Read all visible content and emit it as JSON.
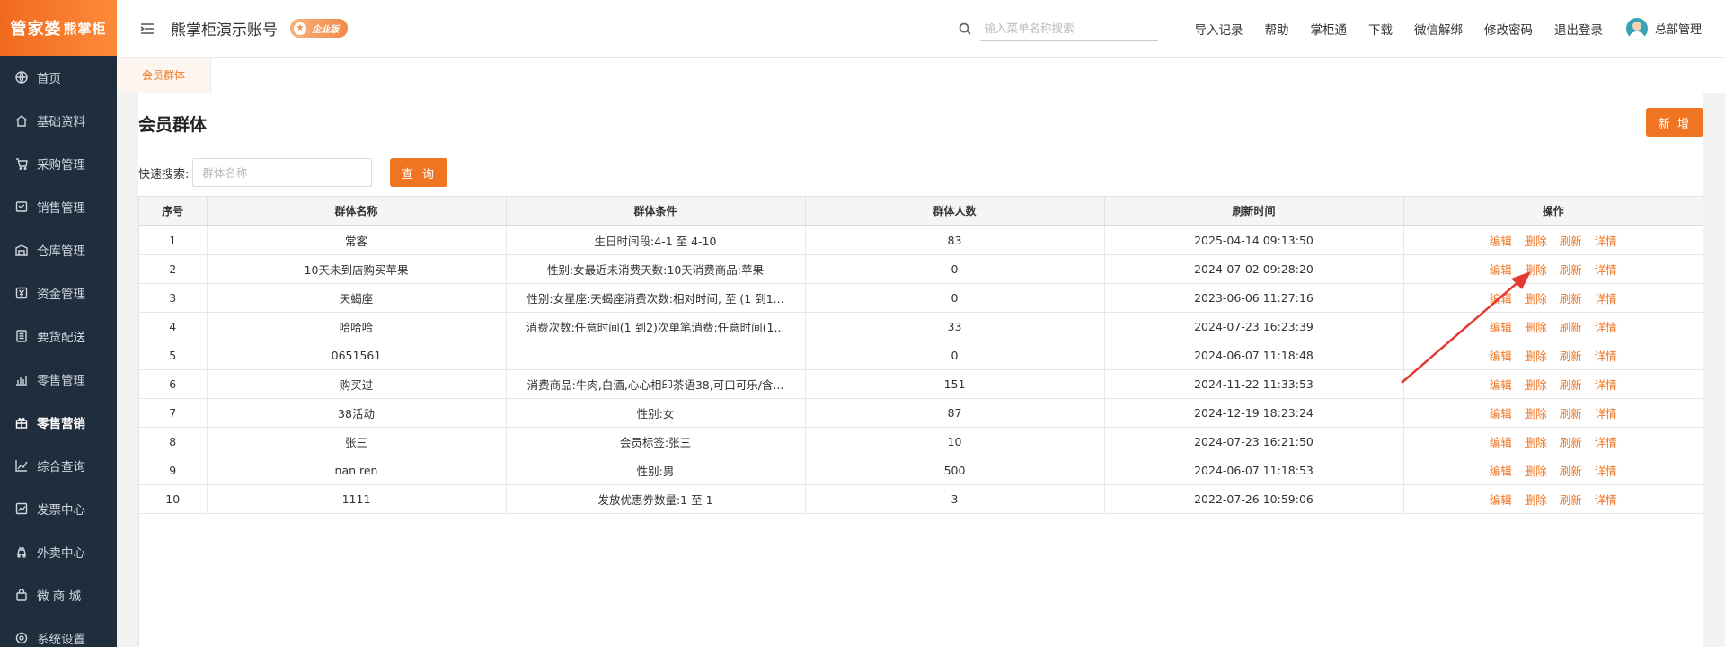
{
  "sidebar": {
    "logo_main": "管家婆",
    "logo_sub": "熊掌柜",
    "items": [
      {
        "label": "首页",
        "icon": "globe-icon"
      },
      {
        "label": "基础资料",
        "icon": "home-icon"
      },
      {
        "label": "采购管理",
        "icon": "cart-icon"
      },
      {
        "label": "销售管理",
        "icon": "sales-icon"
      },
      {
        "label": "仓库管理",
        "icon": "warehouse-icon"
      },
      {
        "label": "资金管理",
        "icon": "money-icon"
      },
      {
        "label": "要货配送",
        "icon": "document-icon"
      },
      {
        "label": "零售管理",
        "icon": "bar-chart-icon"
      },
      {
        "label": "零售营销",
        "icon": "gift-icon"
      },
      {
        "label": "综合查询",
        "icon": "line-chart-icon"
      },
      {
        "label": "发票中心",
        "icon": "trend-icon"
      },
      {
        "label": "外卖中心",
        "icon": "delivery-icon"
      },
      {
        "label": "微 商 城",
        "icon": "bag-icon"
      },
      {
        "label": "系统设置",
        "icon": "settings-icon"
      }
    ]
  },
  "header": {
    "account_name": "熊掌柜演示账号",
    "edition_badge": "企业版",
    "search_placeholder": "输入菜单名称搜索",
    "links": [
      "导入记录",
      "帮助",
      "掌柜通",
      "下载",
      "微信解绑",
      "修改密码",
      "退出登录"
    ],
    "user_name": "总部管理"
  },
  "tabs": [
    {
      "label": "会员群体"
    }
  ],
  "main": {
    "title": "会员群体",
    "add_label": "新 增",
    "search_label": "快速搜索:",
    "search_placeholder": "群体名称",
    "query_label": "查 询"
  },
  "table": {
    "headers": [
      "序号",
      "群体名称",
      "群体条件",
      "群体人数",
      "刷新时间",
      "操作"
    ],
    "rows": [
      {
        "no": "1",
        "name": "常客",
        "cond": "生日时间段:4-1 至 4-10",
        "count": "83",
        "time": "2025-04-14 09:13:50"
      },
      {
        "no": "2",
        "name": "10天未到店购买苹果",
        "cond": "性别:女最近未消费天数:10天消费商品:苹果",
        "count": "0",
        "time": "2024-07-02 09:28:20"
      },
      {
        "no": "3",
        "name": "天蝎座",
        "cond": "性别:女星座:天蝎座消费次数:相对时间, 至 (1 到1...",
        "count": "0",
        "time": "2023-06-06 11:27:16"
      },
      {
        "no": "4",
        "name": "哈哈哈",
        "cond": "消费次数:任意时间(1 到2)次单笔消费:任意时间(1...",
        "count": "33",
        "time": "2024-07-23 16:23:39"
      },
      {
        "no": "5",
        "name": "0651561",
        "cond": "",
        "count": "0",
        "time": "2024-06-07 11:18:48"
      },
      {
        "no": "6",
        "name": "购买过",
        "cond": "消费商品:牛肉,白酒,心心相印茶语38,可口可乐/含...",
        "count": "151",
        "time": "2024-11-22 11:33:53"
      },
      {
        "no": "7",
        "name": "38活动",
        "cond": "性别:女",
        "count": "87",
        "time": "2024-12-19 18:23:24"
      },
      {
        "no": "8",
        "name": "张三",
        "cond": "会员标签:张三",
        "count": "10",
        "time": "2024-07-23 16:21:50"
      },
      {
        "no": "9",
        "name": "nan ren",
        "cond": "性别:男",
        "count": "500",
        "time": "2024-06-07 11:18:53"
      },
      {
        "no": "10",
        "name": "1111",
        "cond": "发放优惠券数量:1 至 1",
        "count": "3",
        "time": "2022-07-26 10:59:06"
      }
    ],
    "actions": [
      "编辑",
      "删除",
      "刷新",
      "详情"
    ]
  },
  "colors": {
    "accent": "#f07522",
    "sidebar": "#1f2d3d",
    "annotation": "#e53935"
  }
}
